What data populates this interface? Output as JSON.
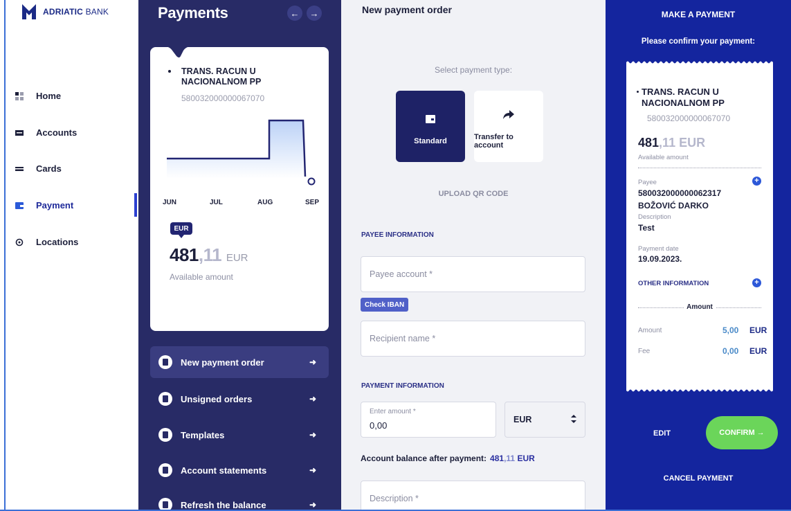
{
  "brand": {
    "name_bold": "ADRIATIC",
    "name_rest": " BANK"
  },
  "nav": {
    "items": [
      {
        "label": "Home",
        "icon": "grid-icon"
      },
      {
        "label": "Accounts",
        "icon": "accounts-icon"
      },
      {
        "label": "Cards",
        "icon": "card-icon"
      },
      {
        "label": "Payment",
        "icon": "wallet-icon",
        "active": true
      },
      {
        "label": "Locations",
        "icon": "location-icon"
      }
    ]
  },
  "payments_panel": {
    "title": "Payments",
    "prev_icon": "arrow-left-icon",
    "next_icon": "arrow-right-icon",
    "account_card": {
      "account_name": "TRANS. RACUN U NACIONALNOM PP",
      "account_number": "580032000000067070",
      "months": [
        "JUN",
        "JUL",
        "AUG",
        "SEP"
      ],
      "currency_badge": "EUR",
      "amount_int": "481",
      "amount_dec": ",11",
      "amount_currency": "EUR",
      "amount_caption": "Available amount"
    },
    "menu": [
      {
        "label": "New payment order",
        "active": true
      },
      {
        "label": "Unsigned orders"
      },
      {
        "label": "Templates"
      },
      {
        "label": "Account statements"
      },
      {
        "label": "Refresh the balance"
      }
    ]
  },
  "form": {
    "title": "New payment order",
    "select_type_label": "Select payment type:",
    "types": [
      {
        "label": "Standard",
        "icon": "wallet-icon",
        "selected": true
      },
      {
        "label": "Transfer to account",
        "icon": "share-arrow-icon"
      }
    ],
    "upload_qr": "UPLOAD QR CODE",
    "payee_section": "PAYEE INFORMATION",
    "payee_account_placeholder": "Payee account *",
    "check_iban": "Check IBAN",
    "recipient_placeholder": "Recipient name *",
    "payment_section": "PAYMENT INFORMATION",
    "amount_label": "Enter amount *",
    "amount_value": "0,00",
    "currency_value": "EUR",
    "balance_after_label": "Account balance after payment:",
    "balance_after_int": "481",
    "balance_after_dec": ",11",
    "balance_after_cur": "EUR",
    "description_placeholder": "Description *"
  },
  "confirm": {
    "title": "MAKE A PAYMENT",
    "subtitle": "Please confirm your payment:",
    "account_name": "TRANS. RACUN U NACIONALNOM PP",
    "account_number": "580032000000067070",
    "amount_int": "481",
    "amount_dec": ",11",
    "amount_cur": " EUR",
    "amount_caption": "Available amount",
    "payee_label": "Payee",
    "payee_account": "580032000000062317",
    "payee_name": "BOŽOVIĆ DARKO",
    "description_label": "Description",
    "description_value": "Test",
    "date_label": "Payment date",
    "date_value": "19.09.2023.",
    "other_info": "OTHER INFORMATION",
    "amount_header": "Amount",
    "amount_row_label": "Amount",
    "amount_row_value": "5,00",
    "amount_row_cur": "EUR",
    "fee_row_label": "Fee",
    "fee_row_value": "0,00",
    "fee_row_cur": "EUR",
    "edit": "EDIT",
    "confirm_btn": "CONFIRM →",
    "cancel": "CANCEL PAYMENT"
  },
  "colors": {
    "nav_panel": "#282b66",
    "confirm_panel": "#14259e",
    "confirm_button": "#6bd55a",
    "accent": "#2b3fd0"
  }
}
